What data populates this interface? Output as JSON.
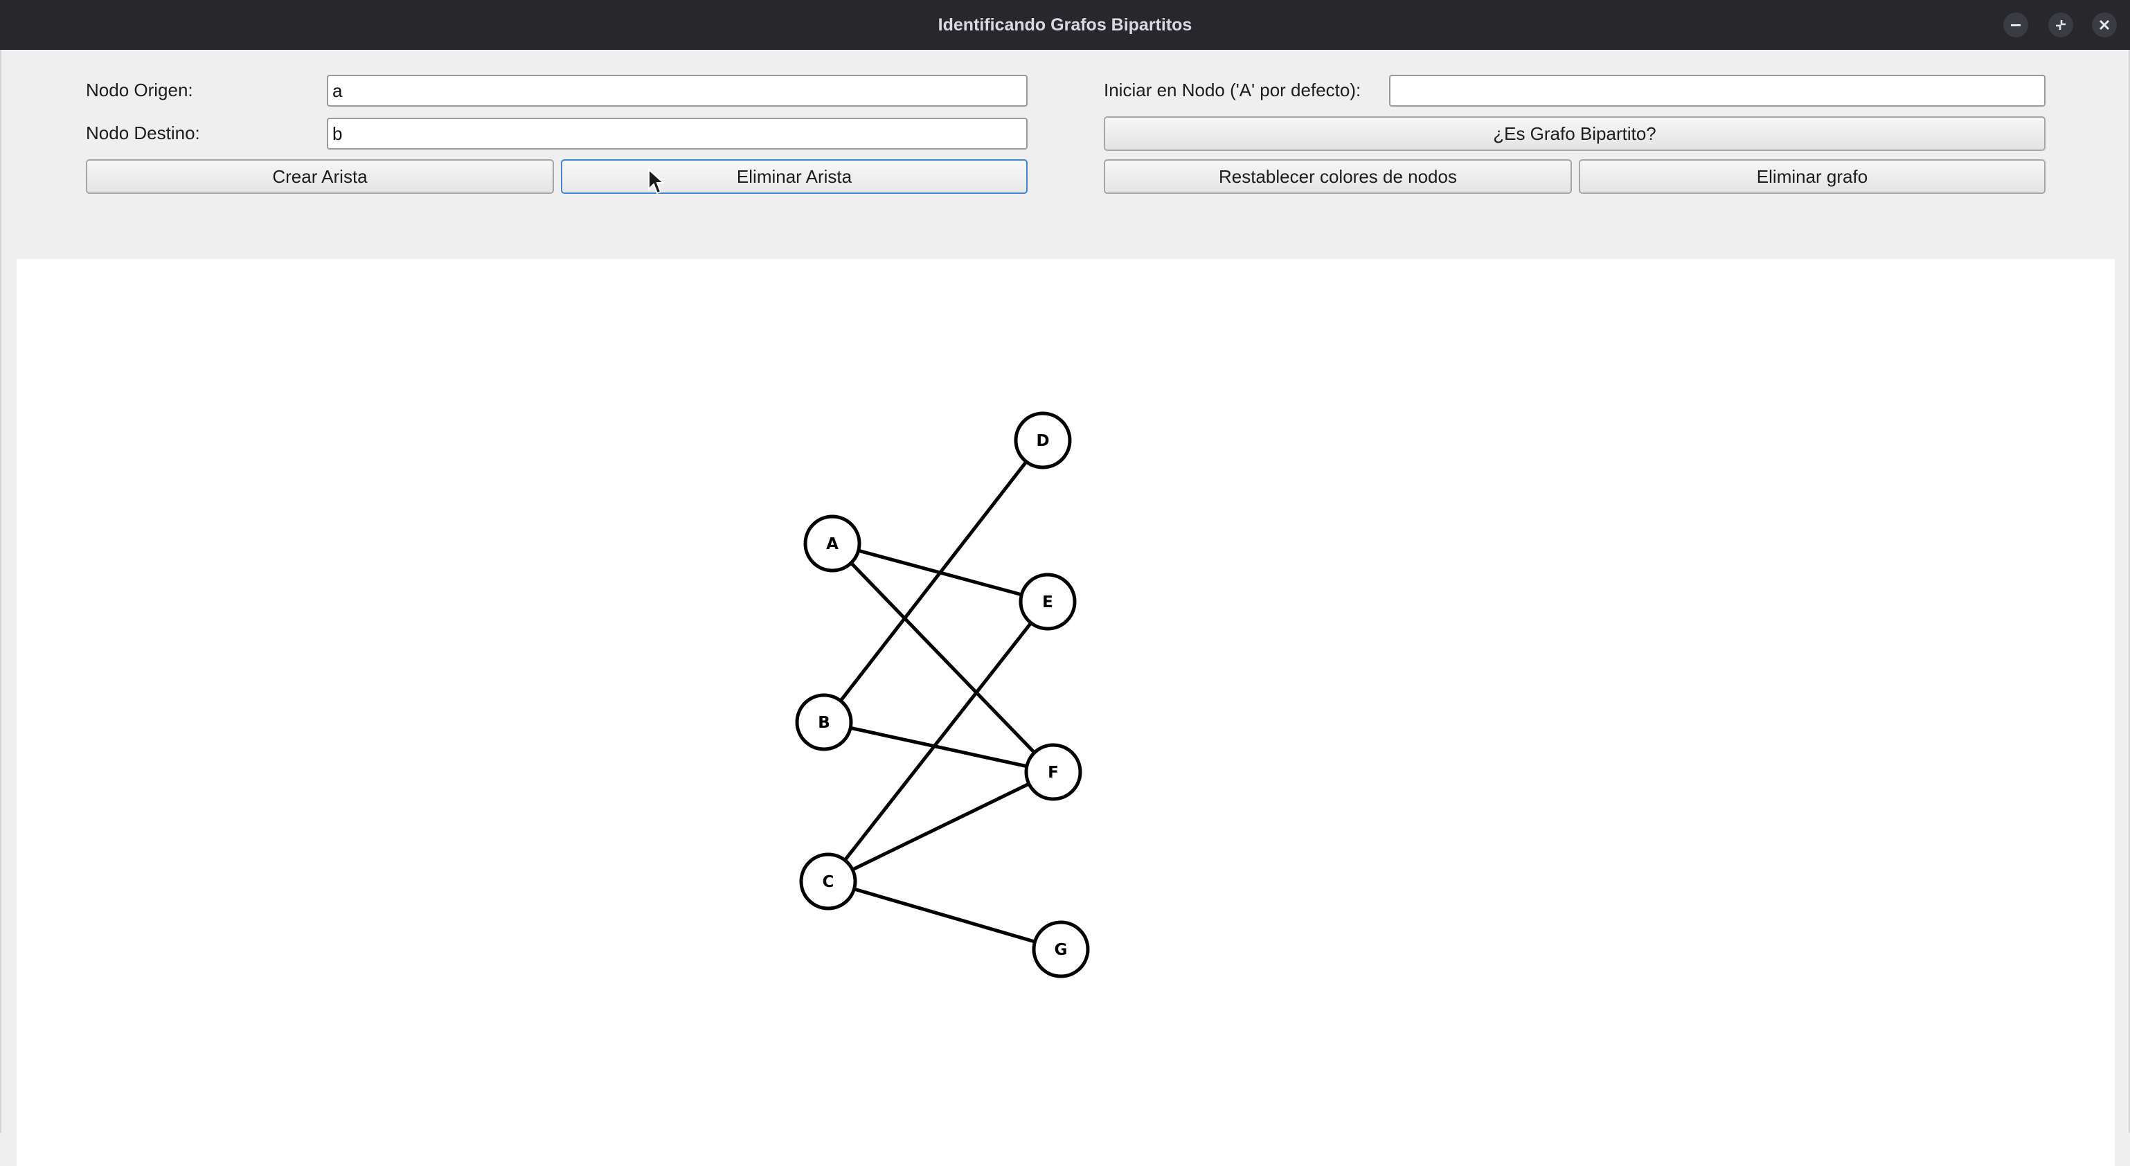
{
  "window": {
    "title": "Identificando Grafos Bipartitos",
    "controls": [
      "minimize-icon",
      "restore-icon",
      "close-icon"
    ]
  },
  "form": {
    "origin_label": "Nodo Origen:",
    "origin_value": "a",
    "dest_label": "Nodo Destino:",
    "dest_value": "b",
    "start_label": "Iniciar en Nodo ('A' por defecto):",
    "start_value": "",
    "create_edge": "Crear Arista",
    "delete_edge": "Eliminar Arista",
    "check_bipartite": "¿Es Grafo Bipartito?",
    "reset_colors": "Restablecer colores de nodos",
    "delete_graph": "Eliminar grafo"
  },
  "graph": {
    "nodes": [
      "A",
      "B",
      "C",
      "D",
      "E",
      "F",
      "G"
    ],
    "edges": [
      [
        "A",
        "E"
      ],
      [
        "A",
        "F"
      ],
      [
        "B",
        "D"
      ],
      [
        "B",
        "F"
      ],
      [
        "C",
        "E"
      ],
      [
        "C",
        "F"
      ],
      [
        "C",
        "G"
      ]
    ]
  },
  "colors": {
    "titlebar": "#27272c",
    "focus_border": "#3d86d6",
    "node_fill": "#ffffff",
    "stroke": "#000000"
  }
}
